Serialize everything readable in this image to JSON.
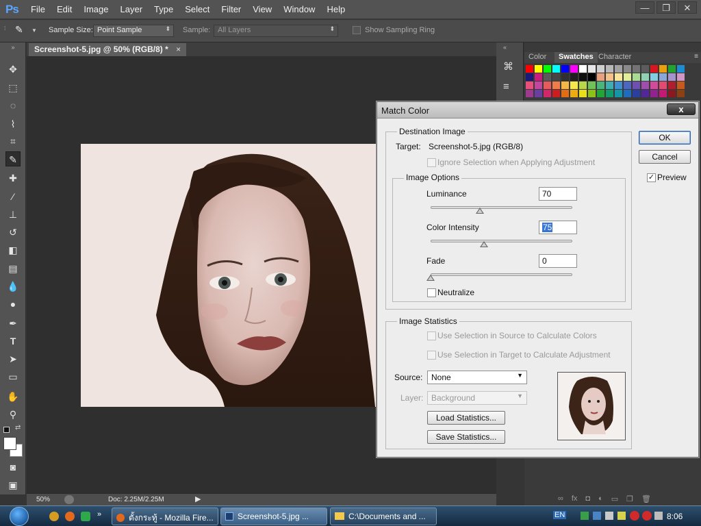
{
  "app": {
    "logo": "Ps"
  },
  "menu": [
    "File",
    "Edit",
    "Image",
    "Layer",
    "Type",
    "Select",
    "Filter",
    "View",
    "Window",
    "Help"
  ],
  "window_buttons": {
    "minimize": "—",
    "restore": "❐",
    "close": "✕"
  },
  "options_bar": {
    "sample_size_label": "Sample Size:",
    "sample_size_value": "Point Sample",
    "sample_label": "Sample:",
    "sample_value": "All Layers",
    "sampling_ring_label": "Show Sampling Ring"
  },
  "document": {
    "tab_title": "Screenshot-5.jpg @ 50% (RGB/8) *",
    "tab_close": "×"
  },
  "status_bar": {
    "zoom": "50%",
    "doc_info": "Doc: 2.25M/2.25M"
  },
  "panel": {
    "tabs": [
      "Color",
      "Swatches",
      "Character"
    ],
    "active_tab": "Swatches",
    "swatch_rows": [
      [
        "#ff0000",
        "#ffff00",
        "#00ff00",
        "#00ffff",
        "#0000ff",
        "#ff00ff",
        "#ffffff",
        "#e6e6e6",
        "#cfcfcf",
        "#b8b8b8",
        "#a1a1a1",
        "#8a8a8a",
        "#737373",
        "#5c5c5c",
        "#d7161f",
        "#eaa00d",
        "#22a32e",
        "#1d8cd0"
      ],
      [
        "#1a1a7a",
        "#c81d7a",
        "#5a5a5a",
        "#454545",
        "#303030",
        "#1f1f1f",
        "#101010",
        "#000000",
        "#e8a07e",
        "#f3c28b",
        "#fae69b",
        "#e0ee9a",
        "#a9dc91",
        "#8fd1b0",
        "#84cde1",
        "#8aa7d8",
        "#a593ce",
        "#d396c4"
      ],
      [
        "#e84f7b",
        "#c3469c",
        "#e65c5c",
        "#ef7d4a",
        "#f5b547",
        "#f3e94a",
        "#b7d84b",
        "#6fc158",
        "#4ab47a",
        "#3faeb3",
        "#3f8fd0",
        "#4e66c0",
        "#6f50b2",
        "#a04eab",
        "#d14c98",
        "#e04b71",
        "#b01d2f",
        "#c65a1c"
      ],
      [
        "#9e3a8e",
        "#6a3ea0",
        "#d3276a",
        "#cc1e1e",
        "#e06c16",
        "#eeaa11",
        "#e8e01a",
        "#8bc21a",
        "#22a537",
        "#119a6a",
        "#1296a8",
        "#1f6cbf",
        "#2a3fa0",
        "#53279a",
        "#91228f",
        "#c41a73",
        "#8a1820",
        "#8c3f10"
      ]
    ]
  },
  "dialog": {
    "title": "Match Color",
    "close": "x",
    "destination_group": "Destination Image",
    "target_label": "Target:",
    "target_value": "Screenshot-5.jpg (RGB/8)",
    "ignore_selection": "Ignore Selection when Applying Adjustment",
    "image_options_group": "Image Options",
    "luminance_label": "Luminance",
    "luminance_value": "70",
    "luminance_level": 70,
    "color_intensity_label": "Color Intensity",
    "color_intensity_value": "75",
    "color_intensity_level": 75,
    "fade_label": "Fade",
    "fade_value": "0",
    "fade_level": 0,
    "neutralize_label": "Neutralize",
    "image_statistics_group": "Image Statistics",
    "use_selection_source": "Use Selection in Source to Calculate Colors",
    "use_selection_target": "Use Selection in Target to Calculate Adjustment",
    "source_label": "Source:",
    "source_value": "None",
    "layer_label": "Layer:",
    "layer_value": "Background",
    "load_statistics": "Load Statistics...",
    "save_statistics": "Save Statistics...",
    "ok": "OK",
    "cancel": "Cancel",
    "preview_label": "Preview",
    "preview_checked": true
  },
  "taskbar": {
    "tasks": [
      {
        "label": "ตั้งกระทู้ - Mozilla Fire..."
      },
      {
        "label": "Screenshot-5.jpg ..."
      },
      {
        "label": "C:\\Documents and ..."
      }
    ],
    "language": "EN",
    "clock": "8:06"
  }
}
